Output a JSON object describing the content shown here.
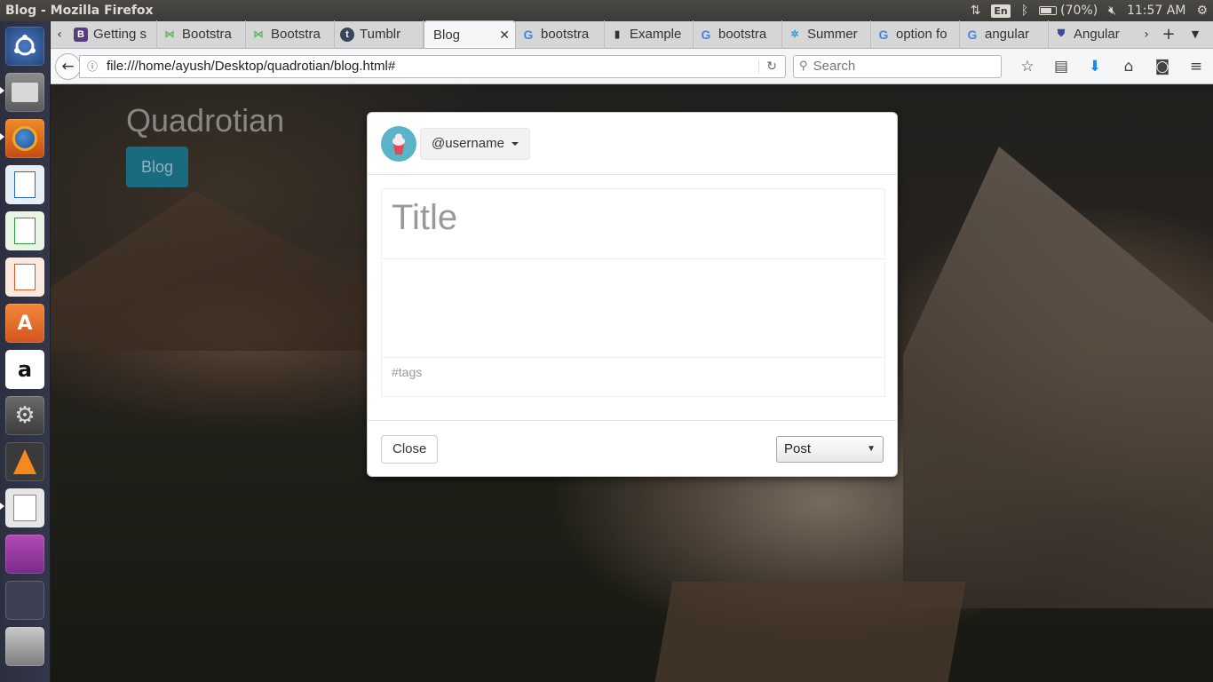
{
  "system": {
    "window_title": "Blog - Mozilla Firefox",
    "language": "En",
    "battery": "(70%)",
    "clock": "11:57 AM"
  },
  "tabs": [
    {
      "label": "Getting s",
      "icon": "bootstrap-icon",
      "active": false
    },
    {
      "label": "Bootstra",
      "icon": "bootsnipp-icon",
      "active": false
    },
    {
      "label": "Bootstra",
      "icon": "bootsnipp-icon",
      "active": false
    },
    {
      "label": "Tumblr",
      "icon": "tumblr-icon",
      "active": false
    },
    {
      "label": "Blog",
      "icon": "",
      "active": true
    },
    {
      "label": "bootstra",
      "icon": "google-icon",
      "active": false
    },
    {
      "label": "Example",
      "icon": "book-icon",
      "active": false
    },
    {
      "label": "bootstra",
      "icon": "google-icon",
      "active": false
    },
    {
      "label": "Summer",
      "icon": "summernote-icon",
      "active": false
    },
    {
      "label": "option fo",
      "icon": "google-icon",
      "active": false
    },
    {
      "label": "angular",
      "icon": "google-icon",
      "active": false
    },
    {
      "label": "Angular",
      "icon": "angular-icon",
      "active": false
    }
  ],
  "navbar": {
    "url": "file:///home/ayush/Desktop/quadrotian/blog.html#",
    "search_placeholder": "Search"
  },
  "page": {
    "brand": "Quadrotian",
    "blog_button": "Blog"
  },
  "modal": {
    "username": "@username",
    "title_placeholder": "Title",
    "body_placeholder": "",
    "tags_placeholder": "#tags",
    "close_label": "Close",
    "post_select_value": "Post"
  },
  "colors": {
    "brand_button": "#1a6a80",
    "avatar_bg": "#5bb3c8"
  }
}
